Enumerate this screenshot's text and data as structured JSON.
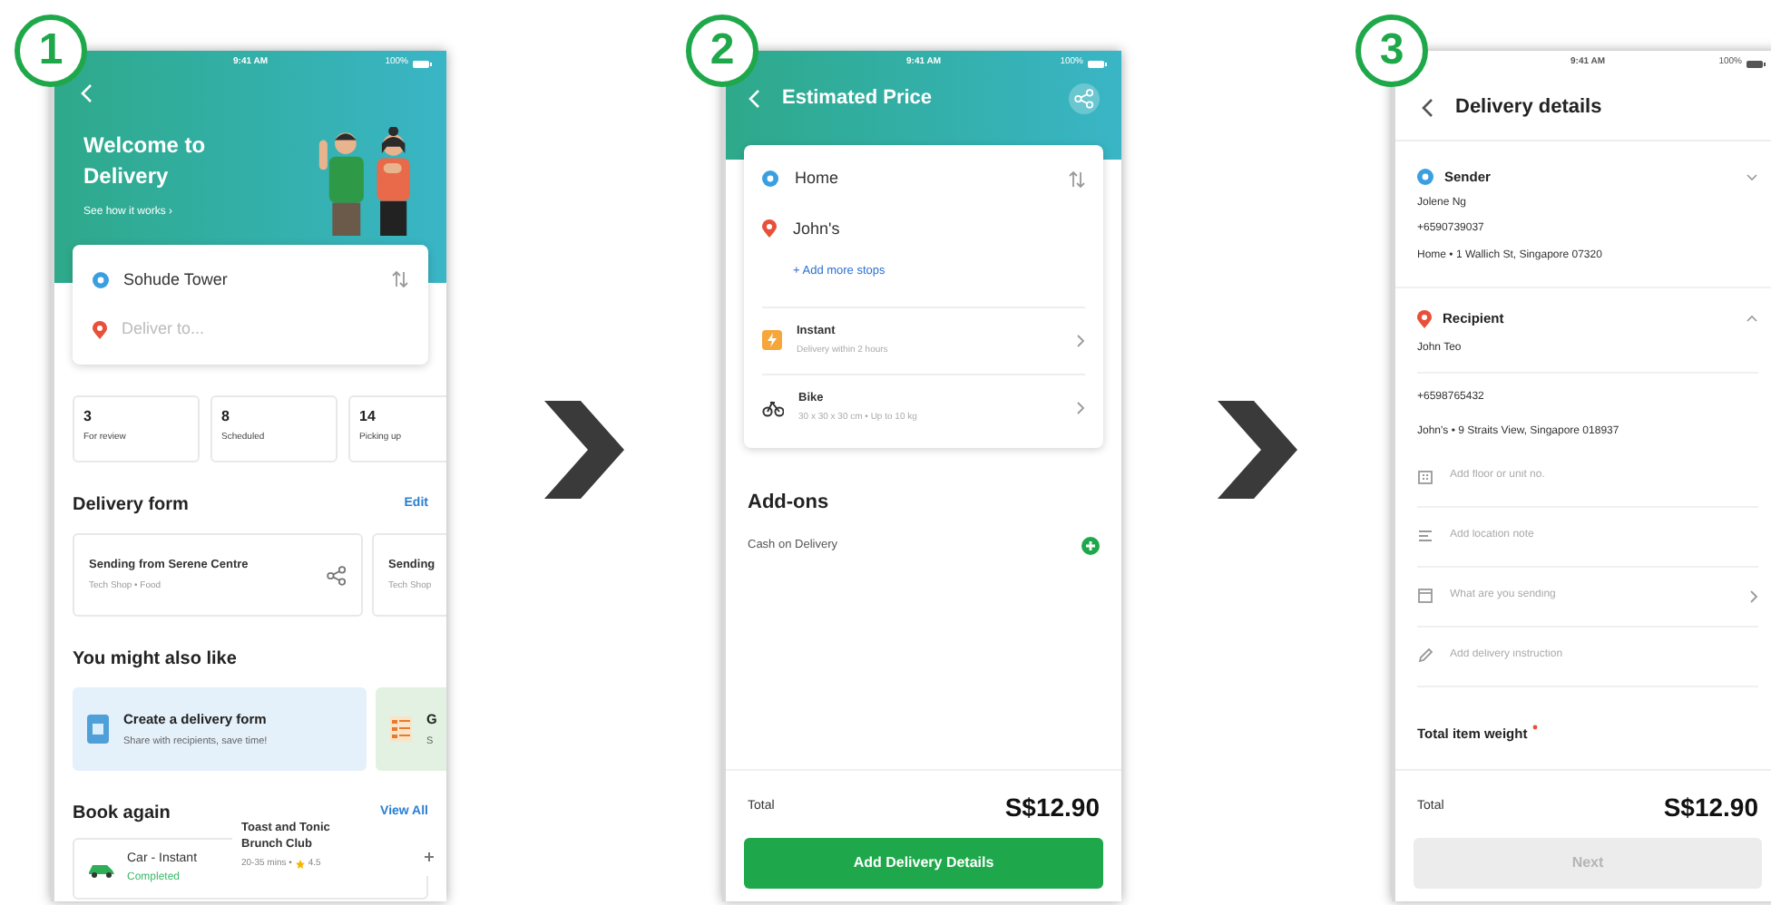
{
  "screen_1": {
    "step": "1",
    "status_bar": {
      "time": "9:41 AM",
      "battery": "100%"
    },
    "banner": {
      "title": "Welcome to Delivery",
      "link": "See how it works ›"
    },
    "route": {
      "pickup": "Sohude Tower",
      "dropoff_placeholder": "Deliver to..."
    },
    "stats": [
      {
        "count": "3",
        "label": "For review"
      },
      {
        "count": "8",
        "label": "Scheduled"
      },
      {
        "count": "14",
        "label": "Picking up"
      }
    ],
    "delivery_form": {
      "heading": "Delivery form",
      "action": "Edit",
      "cards": [
        {
          "title": "Sending from Serene Centre",
          "subtitle": "Tech Shop • Food"
        },
        {
          "title": "Sending",
          "subtitle": "Tech Shop"
        }
      ]
    },
    "suggestions": {
      "heading": "You might also like",
      "cards": [
        {
          "title": "Create a delivery form",
          "subtitle": "Share with recipients, save time!",
          "color": "#e4f0fa"
        },
        {
          "title": "G",
          "subtitle": "S",
          "color": "#e2f1e1"
        }
      ]
    },
    "book_again": {
      "heading": "Book again",
      "action": "View All",
      "item": {
        "title": "Car - Instant",
        "status": "Completed"
      },
      "popup": {
        "title": "Toast and Tonic Brunch Club",
        "meta": "20-35 mins •",
        "rating": "4.5"
      }
    }
  },
  "screen_2": {
    "step": "2",
    "status_bar": {
      "time": "9:41 AM",
      "battery": "100%"
    },
    "title": "Estimated Price",
    "route": {
      "pickup": "Home",
      "dropoff": "John's",
      "add_stops": "+ Add more stops"
    },
    "options": [
      {
        "kind": "speed",
        "title": "Instant",
        "subtitle": "Delivery within 2 hours"
      },
      {
        "kind": "vehicle",
        "title": "Bike",
        "subtitle": "30 x 30 x 30 cm • Up to 10 kg"
      }
    ],
    "addons": {
      "heading": "Add-ons",
      "items": [
        {
          "label": "Cash on Delivery"
        }
      ]
    },
    "total": {
      "label": "Total",
      "amount": "S$12.90"
    },
    "button": {
      "label": "Add Delivery Details",
      "disabled": false
    }
  },
  "screen_3": {
    "step": "3",
    "status_bar": {
      "time": "9:41 AM",
      "battery": "100%"
    },
    "title": "Delivery details",
    "sender": {
      "heading": "Sender",
      "expanded": false,
      "name": "Jolene Ng",
      "phone": "+6590739037",
      "address": "Home • 1 Wallich St, Singapore 07320"
    },
    "recipient": {
      "heading": "Recipient",
      "expanded": true,
      "name": "John Teo",
      "phone": "+6598765432",
      "address": "John's • 9 Straits View, Singapore 018937"
    },
    "fields": [
      {
        "kind": "unit",
        "placeholder": "Add floor or unit no.",
        "chevron": false
      },
      {
        "kind": "note",
        "placeholder": "Add location note",
        "chevron": false
      },
      {
        "kind": "item",
        "placeholder": "What are you sending",
        "chevron": true
      },
      {
        "kind": "instruction",
        "placeholder": "Add delivery instruction",
        "chevron": false
      }
    ],
    "weight": {
      "label": "Total item weight",
      "required": true
    },
    "total": {
      "label": "Total",
      "amount": "S$12.90"
    },
    "button": {
      "label": "Next",
      "disabled": true
    }
  }
}
